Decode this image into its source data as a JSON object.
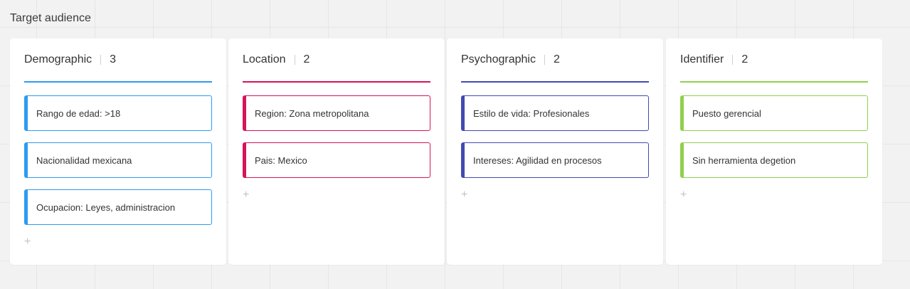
{
  "board": {
    "title": "Target audience"
  },
  "columns": [
    {
      "name": "Demographic",
      "count": "3",
      "accent": "#2d9bf0",
      "cards": [
        {
          "text": "Rango de edad: >18"
        },
        {
          "text": "Nacionalidad mexicana"
        },
        {
          "text": "Ocupacion: Leyes, administracion"
        }
      ],
      "add_icon": "plus-icon"
    },
    {
      "name": "Location",
      "count": "2",
      "accent": "#d5145a",
      "cards": [
        {
          "text": "Region: Zona metropolitana"
        },
        {
          "text": "Pais: Mexico"
        }
      ],
      "add_icon": "plus-icon"
    },
    {
      "name": "Psychographic",
      "count": "2",
      "accent": "#414bb2",
      "cards": [
        {
          "text": "Estilo de vida: Profesionales"
        },
        {
          "text": "Intereses: Agilidad en procesos"
        }
      ],
      "add_icon": "plus-icon"
    },
    {
      "name": "Identifier",
      "count": "2",
      "accent": "#8fd14f",
      "cards": [
        {
          "text": "Puesto gerencial"
        },
        {
          "text": "Sin herramienta degetion"
        }
      ],
      "add_icon": "plus-icon"
    }
  ]
}
